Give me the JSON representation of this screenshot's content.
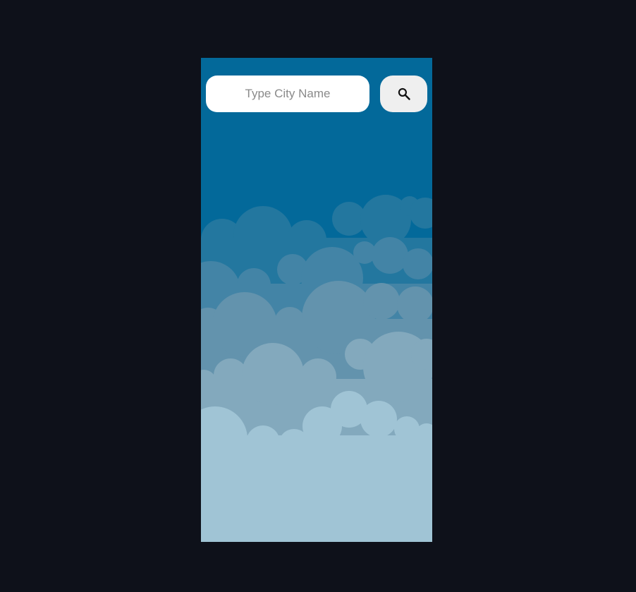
{
  "search": {
    "placeholder": "Type City Name",
    "value": "",
    "button_icon": "search-icon"
  },
  "colors": {
    "page_background": "#0e111a",
    "sky": "#03699a",
    "cloud_layer_1": "#23779f",
    "cloud_layer_2": "#4384a6",
    "cloud_layer_3": "#6393ad",
    "cloud_layer_4": "#83a9bd",
    "cloud_layer_5": "#a0c4d5",
    "input_background": "#ffffff",
    "button_background": "#efefef"
  }
}
